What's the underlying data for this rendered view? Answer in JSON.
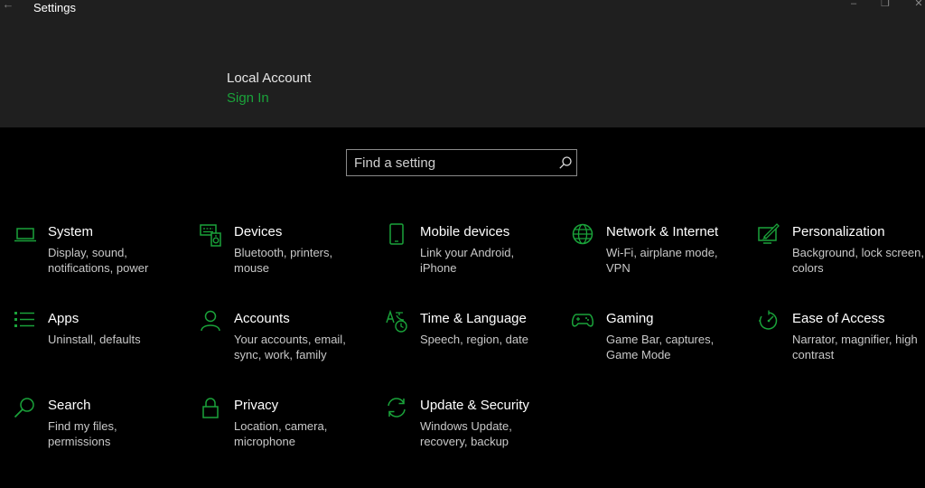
{
  "window": {
    "title": "Settings",
    "back_icon": "back-arrow-icon",
    "controls": {
      "minimize": "–",
      "maximize": "❐",
      "close": "✕"
    }
  },
  "account": {
    "name": "Local Account",
    "sign_in_label": "Sign In",
    "link_color": "#1aa33a"
  },
  "search": {
    "placeholder": "Find a setting",
    "value": "",
    "icon": "search-icon"
  },
  "accent_color": "#1aa33a",
  "categories": [
    {
      "title": "System",
      "desc": "Display, sound, notifications, power",
      "icon": "laptop-icon"
    },
    {
      "title": "Devices",
      "desc": "Bluetooth, printers, mouse",
      "icon": "keyboard-speaker-icon"
    },
    {
      "title": "Mobile devices",
      "desc": "Link your Android, iPhone",
      "icon": "phone-icon"
    },
    {
      "title": "Network & Internet",
      "desc": "Wi-Fi, airplane mode, VPN",
      "icon": "globe-icon"
    },
    {
      "title": "Personalization",
      "desc": "Background, lock screen, colors",
      "icon": "paint-monitor-icon"
    },
    {
      "title": "Apps",
      "desc": "Uninstall, defaults",
      "icon": "apps-list-icon"
    },
    {
      "title": "Accounts",
      "desc": "Your accounts, email, sync, work, family",
      "icon": "person-icon"
    },
    {
      "title": "Time & Language",
      "desc": "Speech, region, date",
      "icon": "time-language-icon"
    },
    {
      "title": "Gaming",
      "desc": "Game Bar, captures, Game Mode",
      "icon": "gamepad-icon"
    },
    {
      "title": "Ease of Access",
      "desc": "Narrator, magnifier, high contrast",
      "icon": "ease-of-access-icon"
    },
    {
      "title": "Search",
      "desc": "Find my files, permissions",
      "icon": "search-icon"
    },
    {
      "title": "Privacy",
      "desc": "Location, camera, microphone",
      "icon": "lock-icon"
    },
    {
      "title": "Update & Security",
      "desc": "Windows Update, recovery, backup",
      "icon": "sync-arrows-icon"
    }
  ]
}
